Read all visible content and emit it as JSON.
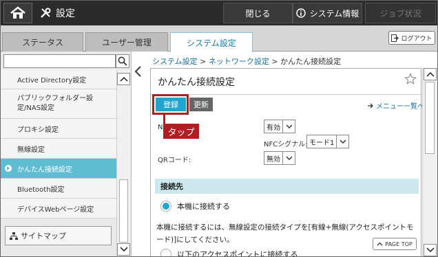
{
  "header": {
    "title": "設定",
    "close_label": "閉じる",
    "system_info_label": "システム情報",
    "job_status_label": "ジョブ状況"
  },
  "tabs": [
    {
      "label": "ステータス",
      "active": false
    },
    {
      "label": "ユーザー管理",
      "active": false
    },
    {
      "label": "システム設定",
      "active": true
    }
  ],
  "logout_label": "ログアウト",
  "sidebar": {
    "search_value": "",
    "items": [
      {
        "label": "Active Directory設定",
        "active": false
      },
      {
        "label": "パブリックフォルダー設定/NAS設定",
        "label_line1": "パブリックフォルダー設",
        "label_line2": "定/NAS設定",
        "active": false
      },
      {
        "label": "プロキシ設定",
        "active": false
      },
      {
        "label": "無線設定",
        "active": false
      },
      {
        "label": "かんたん接続設定",
        "active": true
      },
      {
        "label": "Bluetooth設定",
        "active": false
      },
      {
        "label": "デバイスWebページ設定",
        "active": false
      }
    ],
    "sitemap_label": "サイトマップ"
  },
  "breadcrumb": {
    "items": [
      "システム設定",
      "ネットワーク設定",
      "かんたん接続設定"
    ],
    "separator": ">"
  },
  "page": {
    "title": "かんたん接続設定",
    "register_label": "登録",
    "update_label": "更新",
    "menu_list_label": "メニュー一覧へ",
    "tap_annotation": "タップ",
    "nfc_partial_label": "N",
    "nfc_value": "有効",
    "nfc_signal_label": "NFCシグナル:",
    "nfc_signal_value": "モード1",
    "qr_label": "QRコード:",
    "qr_value": "無効",
    "connection_section": "接続先",
    "radio1_label": "本機に接続する",
    "radio1_selected": true,
    "description": "本機に接続するには、無線設定の接続タイプを[有線+無線(アクセスポイントモード)]にしてください。",
    "radio2_label": "以下のアクセスポイントに接続する",
    "radio2_selected": false,
    "page_top_label": "PAGE TOP"
  },
  "colors": {
    "accent": "#1ea6d0",
    "sidebar_active": "#5fbcd3",
    "annotation_red": "#b01e23",
    "header_bg": "#2b2b2b"
  }
}
